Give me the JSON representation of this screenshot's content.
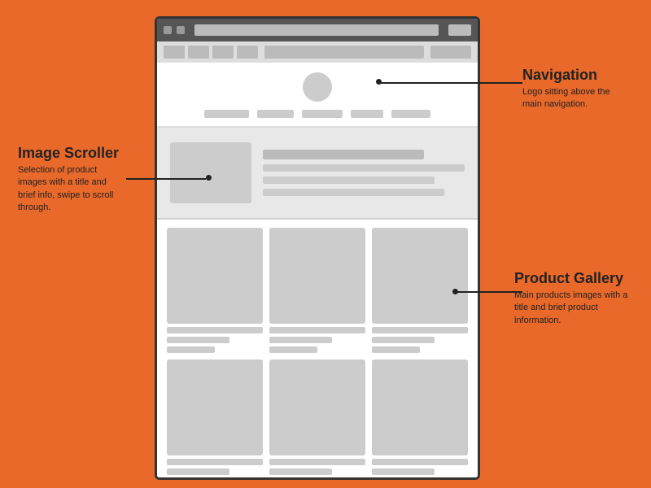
{
  "background_color": "#E8692A",
  "device": {
    "browser_bar": {
      "dots": [
        "dot1",
        "dot2",
        "dot3"
      ]
    }
  },
  "annotations": {
    "navigation": {
      "title": "Navigation",
      "description": "Logo sitting above the main navigation."
    },
    "image_scroller": {
      "title": "Image Scroller",
      "description": "Selection of product images with a title and brief info, swipe to scroll through."
    },
    "product_gallery": {
      "title": "Product Gallery",
      "description": "Main products images with a title and brief product information."
    }
  },
  "nav_links": [
    60,
    45,
    55,
    40,
    50
  ],
  "hero_lines": [
    100,
    80,
    90
  ],
  "gallery_rows": [
    [
      {
        "img": true,
        "lines": [
          70,
          50
        ]
      },
      {
        "img": true,
        "lines": [
          60,
          45
        ]
      },
      {
        "img": true,
        "lines": [
          80,
          55
        ]
      }
    ],
    [
      {
        "img": true,
        "lines": [
          65,
          50
        ]
      },
      {
        "img": true,
        "lines": [
          75,
          45
        ]
      },
      {
        "img": true,
        "lines": [
          70,
          50
        ]
      }
    ]
  ]
}
